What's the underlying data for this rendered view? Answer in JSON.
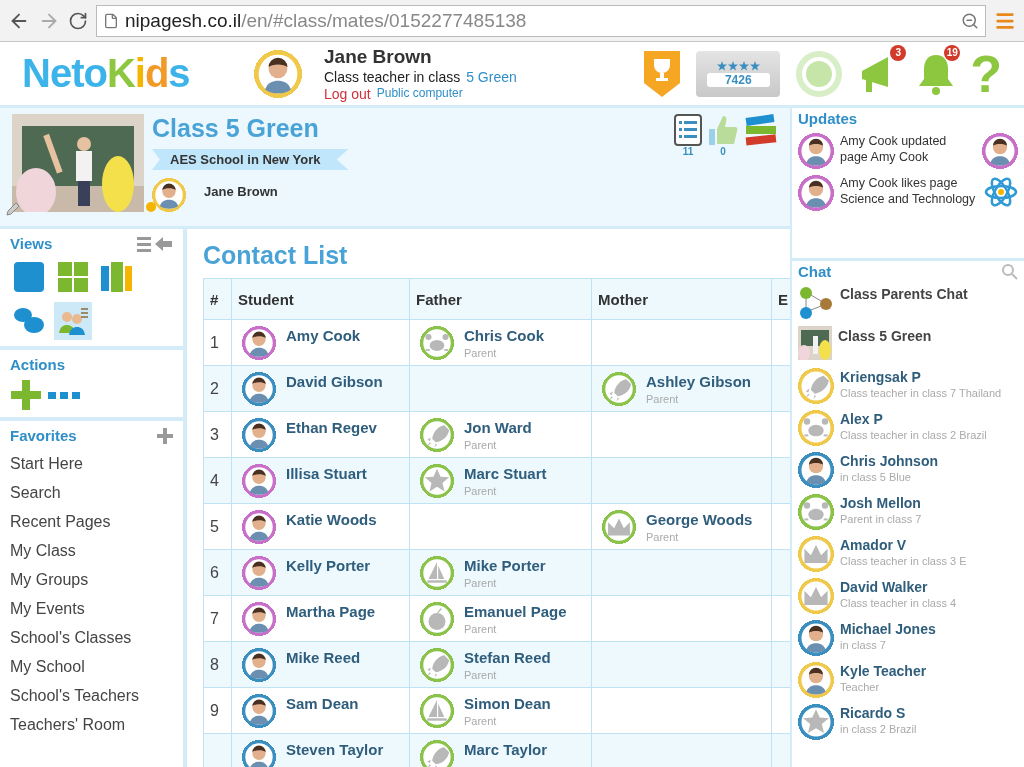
{
  "browser": {
    "url_host": "nipagesh.co.il",
    "url_path": "/en/#class/mates/0152277485138"
  },
  "header": {
    "logo": [
      {
        "text": "Neto",
        "color": "#3cb4ea"
      },
      {
        "text": "K",
        "color": "#8dc63f"
      },
      {
        "text": "i",
        "color": "#f4b400"
      },
      {
        "text": "d",
        "color": "#f29a28"
      },
      {
        "text": "s",
        "color": "#3cb4ea"
      }
    ],
    "user": {
      "name": "Jane Brown",
      "role": "Class teacher in class",
      "class_link": "5 Green",
      "logout": "Log out",
      "public": "Public computer"
    },
    "points": {
      "stars": 4,
      "value": "7426"
    },
    "notifications": [
      {
        "kind": "megaphone",
        "count": "3"
      },
      {
        "kind": "bell",
        "count": "19"
      }
    ],
    "help": "?"
  },
  "class": {
    "title": "Class 5 Green",
    "school": "AES School in New York",
    "teacher": "Jane Brown",
    "online": true,
    "counters": [
      {
        "kind": "list",
        "count": "11"
      },
      {
        "kind": "like",
        "count": "0"
      }
    ]
  },
  "sidebar": {
    "views": {
      "title": "Views",
      "items": [
        {
          "kind": "single",
          "selected": false
        },
        {
          "kind": "grid",
          "selected": false
        },
        {
          "kind": "columns",
          "selected": false
        },
        {
          "kind": "chat",
          "selected": false
        },
        {
          "kind": "contacts",
          "selected": true
        }
      ]
    },
    "actions": {
      "title": "Actions"
    },
    "favorites": {
      "title": "Favorites",
      "items": [
        "Start Here",
        "Search",
        "Recent Pages",
        "My Class",
        "My Groups",
        "My Events",
        "School's Classes",
        "My School",
        "School's Teachers",
        "Teachers' Room"
      ]
    }
  },
  "contacts": {
    "title": "Contact List",
    "columns": [
      "#",
      "Student",
      "Father",
      "Mother",
      "E"
    ],
    "rows": [
      {
        "number": "1",
        "student": {
          "name": "Amy Cook"
        },
        "father": {
          "name": "Chris Cook",
          "role": "Parent",
          "avatar": {
            "kind": "crab",
            "color": "#8bc34a"
          }
        }
      },
      {
        "number": "2",
        "student": {
          "name": "David Gibson"
        },
        "mother": {
          "name": "Ashley Gibson",
          "role": "Parent",
          "avatar": {
            "kind": "rocket",
            "color": "#8bc34a"
          }
        }
      },
      {
        "number": "3",
        "student": {
          "name": "Ethan Regev"
        },
        "father": {
          "name": "Jon Ward",
          "role": "Parent",
          "avatar": {
            "kind": "rocket",
            "color": "#8bc34a"
          }
        }
      },
      {
        "number": "4",
        "student": {
          "name": "Illisa Stuart"
        },
        "father": {
          "name": "Marc Stuart",
          "role": "Parent",
          "avatar": {
            "kind": "star",
            "color": "#8bc34a"
          }
        }
      },
      {
        "number": "5",
        "student": {
          "name": "Katie Woods"
        },
        "mother": {
          "name": "George Woods",
          "role": "Parent",
          "avatar": {
            "kind": "crown",
            "color": "#8bc34a"
          }
        }
      },
      {
        "number": "6",
        "student": {
          "name": "Kelly Porter"
        },
        "father": {
          "name": "Mike Porter",
          "role": "Parent",
          "avatar": {
            "kind": "boat",
            "color": "#8bc34a"
          }
        }
      },
      {
        "number": "7",
        "student": {
          "name": "Martha Page"
        },
        "father": {
          "name": "Emanuel Page",
          "role": "Parent",
          "avatar": {
            "kind": "apple",
            "color": "#8bc34a"
          }
        }
      },
      {
        "number": "8",
        "student": {
          "name": "Mike Reed"
        },
        "father": {
          "name": "Stefan Reed",
          "role": "Parent",
          "avatar": {
            "kind": "rocket",
            "color": "#8bc34a"
          }
        }
      },
      {
        "number": "9",
        "student": {
          "name": "Sam Dean"
        },
        "father": {
          "name": "Simon Dean",
          "role": "Parent",
          "avatar": {
            "kind": "boat",
            "color": "#8bc34a"
          }
        }
      },
      {
        "student": {
          "name": "Steven Taylor"
        },
        "father": {
          "name": "Marc Taylor",
          "avatar": {
            "kind": "rocket",
            "color": "#8bc34a"
          }
        }
      }
    ]
  },
  "updates": {
    "title": "Updates",
    "items": [
      {
        "actor": "Amy Cook",
        "action": "updated page",
        "target": "Amy Cook"
      },
      {
        "actor": "Amy Cook",
        "action": "likes page",
        "target": "Science and Technology",
        "kind": "atom"
      }
    ]
  },
  "chat": {
    "title": "Chat",
    "items": [
      {
        "kind": "group",
        "name": "Class Parents Chat"
      },
      {
        "kind": "class",
        "name": "Class 5 Green"
      },
      {
        "kind": "person",
        "name": "Kriengsak P",
        "subtitle": "Class teacher in class 7 Thailand",
        "avatar": {
          "kind": "rocket",
          "color": "#f0c94a"
        }
      },
      {
        "kind": "person",
        "name": "Alex P",
        "subtitle": "Class teacher in class 2 Brazil",
        "avatar": {
          "kind": "crab",
          "color": "#f0c94a"
        }
      },
      {
        "kind": "person",
        "name": "Chris Johnson",
        "subtitle": "in class 5 Blue"
      },
      {
        "kind": "person",
        "name": "Josh Mellon",
        "subtitle": "Parent in class 7",
        "avatar": {
          "kind": "crab",
          "color": "#8bc34a"
        }
      },
      {
        "kind": "person",
        "name": "Amador V",
        "subtitle": "Class teacher in class 3 E",
        "avatar": {
          "kind": "crown",
          "color": "#f0c94a"
        }
      },
      {
        "kind": "person",
        "name": "David Walker",
        "subtitle": "Class teacher in class 4",
        "avatar": {
          "kind": "crown",
          "color": "#f0c94a"
        }
      },
      {
        "kind": "person",
        "name": "Michael Jones",
        "subtitle": "in class 7"
      },
      {
        "kind": "person",
        "name": "Kyle Teacher",
        "subtitle": "Teacher"
      },
      {
        "kind": "person",
        "name": "Ricardo S",
        "subtitle": "in class 2 Brazil",
        "avatar": {
          "kind": "star",
          "color": "#3a8fc0"
        }
      }
    ]
  }
}
